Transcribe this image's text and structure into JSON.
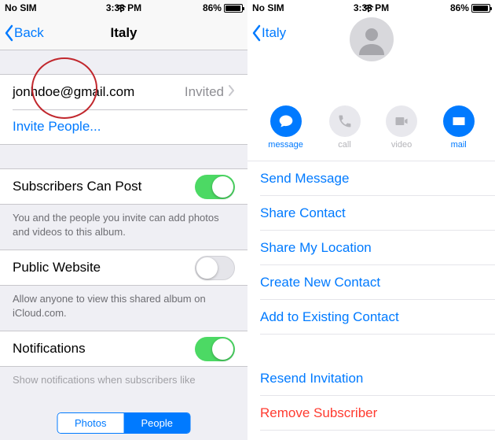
{
  "status": {
    "carrier": "No SIM",
    "wifi": "wifi",
    "time": "3:38 PM",
    "battery_pct": "86%"
  },
  "left": {
    "back_label": "Back",
    "title": "Italy",
    "person_email": "jonhdoe@gmail.com",
    "person_status": "Invited",
    "invite_label": "Invite People...",
    "subs_label": "Subscribers Can Post",
    "subs_note": "You and the people you invite can add photos and videos to this album.",
    "public_label": "Public Website",
    "public_note": "Allow anyone to view this shared album on iCloud.com.",
    "notif_label": "Notifications",
    "notif_note": "Show notifications when subscribers like",
    "seg_photos": "Photos",
    "seg_people": "People"
  },
  "right": {
    "back_label": "Italy",
    "actions": {
      "message": "message",
      "call": "call",
      "video": "video",
      "mail": "mail"
    },
    "menu": {
      "send_message": "Send Message",
      "share_contact": "Share Contact",
      "share_location": "Share My Location",
      "create_contact": "Create New Contact",
      "add_existing": "Add to Existing Contact",
      "resend": "Resend Invitation",
      "remove": "Remove Subscriber"
    }
  }
}
